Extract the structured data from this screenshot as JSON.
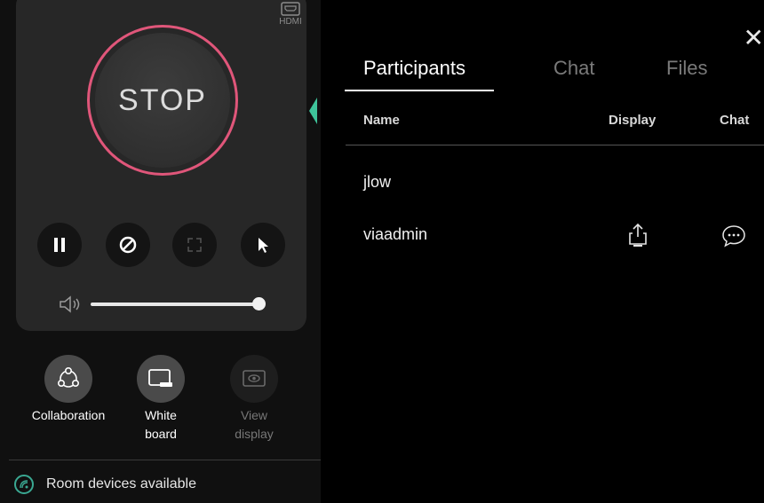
{
  "sidebar": {
    "source_label": "HDMI",
    "stop_label": "STOP",
    "controls": [
      {
        "icon": "pause-icon"
      },
      {
        "icon": "block-icon"
      },
      {
        "icon": "fullscreen-icon"
      },
      {
        "icon": "pointer-icon"
      }
    ],
    "volume_level": 1.0,
    "tools": [
      {
        "label": "Collaboration"
      },
      {
        "label": "White\nboard"
      },
      {
        "label": "View\ndisplay"
      }
    ],
    "room_status": "Room devices available"
  },
  "panel": {
    "tabs": [
      "Participants",
      "Chat",
      "Files"
    ],
    "active_tab": "Participants",
    "columns": {
      "name": "Name",
      "display": "Display",
      "chat": "Chat"
    },
    "participants": [
      {
        "name": "jlow",
        "display_action": false,
        "chat_action": false
      },
      {
        "name": "viaadmin",
        "display_action": true,
        "chat_action": true
      }
    ]
  },
  "colors": {
    "accent": "#3ec49a",
    "stop_ring": "#e0567a"
  }
}
